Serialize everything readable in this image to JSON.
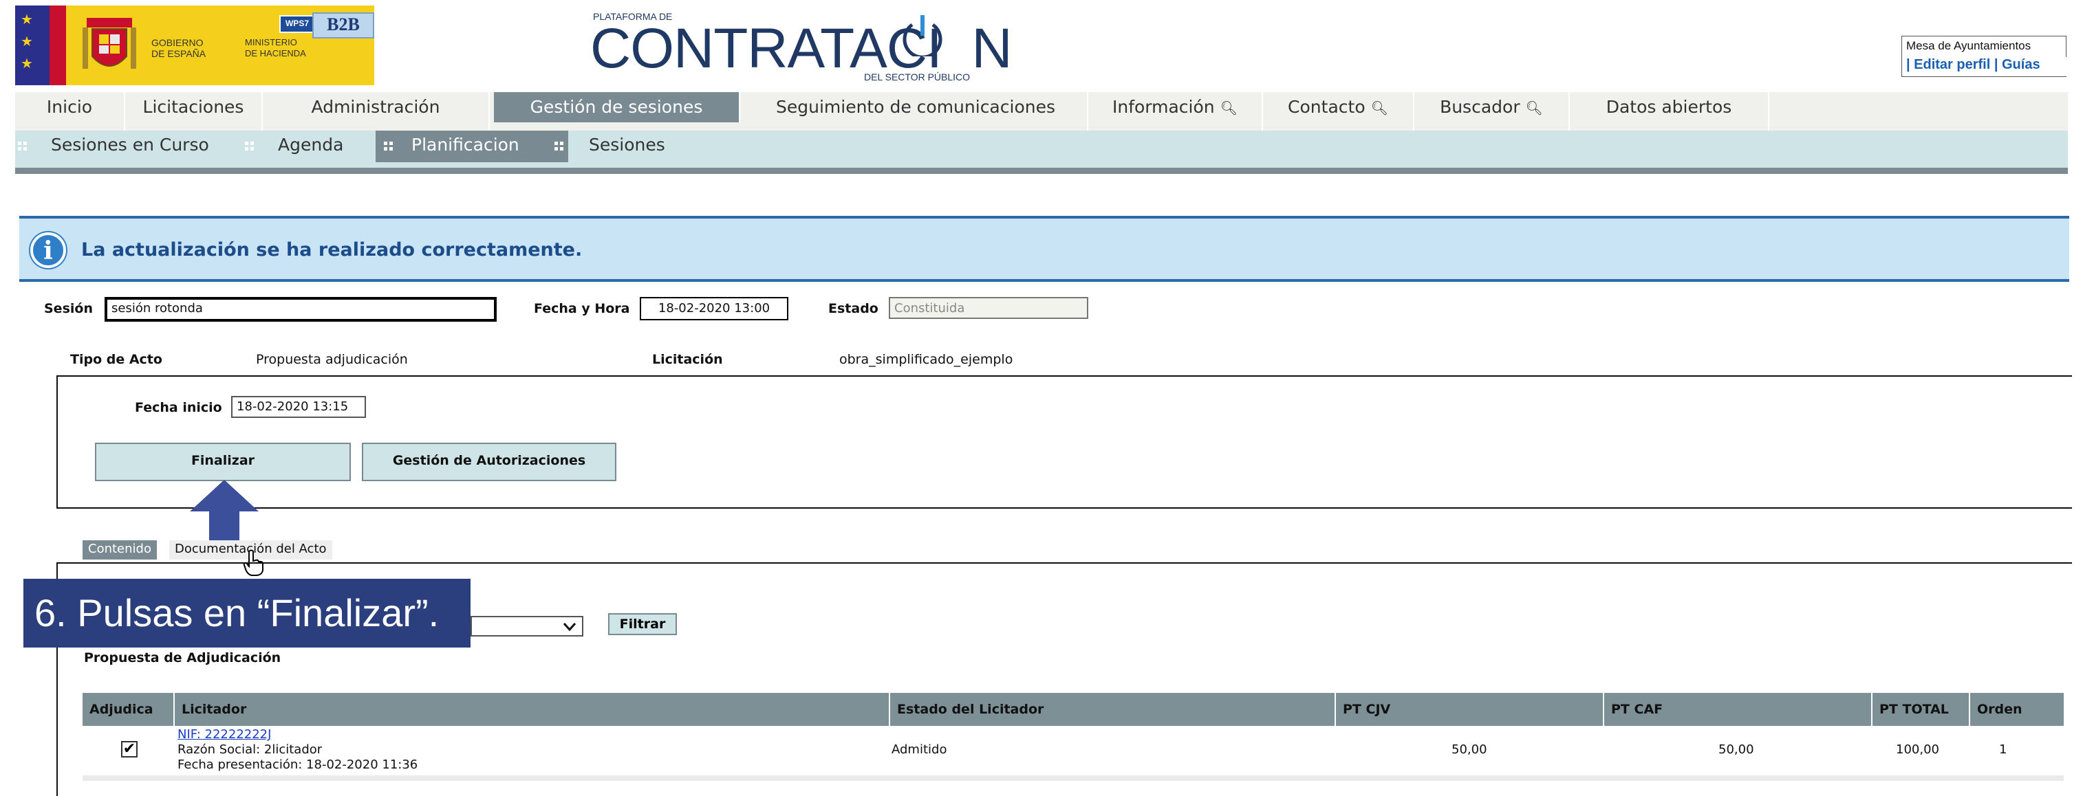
{
  "header": {
    "gobierno": "GOBIERNO\nDE ESPAÑA",
    "ministerio": "MINISTERIO\nDE HACIENDA",
    "wps_badge": "WPS7",
    "b2b_badge": "B2B",
    "platform_small": "PLATAFORMA DE",
    "platform_name": "CONTRATACI  N",
    "platform_sub": "DEL SECTOR PÚBLICO",
    "user_area": "Mesa de Ayuntamientos",
    "user_links": "| Editar perfil | Guías"
  },
  "nav": {
    "items": [
      "Inicio",
      "Licitaciones",
      "Administración",
      "Gestión de sesiones",
      "Seguimiento de comunicaciones",
      "Información",
      "Contacto",
      "Buscador",
      "Datos abiertos"
    ],
    "active": "Gestión de sesiones"
  },
  "subnav": {
    "items": [
      "Sesiones en Curso",
      "Agenda",
      "Planificacion",
      "Sesiones"
    ],
    "active": "Planificacion"
  },
  "info": {
    "message": "La actualización se ha realizado correctamente."
  },
  "session": {
    "sesion_label": "Sesión",
    "sesion_value": "sesión rotonda",
    "fecha_label": "Fecha y Hora",
    "fecha_value": "18-02-2020 13:00",
    "estado_label": "Estado",
    "estado_value": "Constituida",
    "tipo_label": "Tipo de Acto",
    "tipo_value": "Propuesta adjudicación",
    "licitacion_label": "Licitación",
    "licitacion_value": "obra_simplificado_ejemplo"
  },
  "panel": {
    "fecha_inicio_label": "Fecha inicio",
    "fecha_inicio_value": "18-02-2020 13:15",
    "finalizar_label": "Finalizar",
    "autorizaciones_label": "Gestión de Autorizaciones"
  },
  "tabs": {
    "contenido": "Contenido",
    "documentacion": "Documentación del Acto"
  },
  "callout": {
    "text": "6.  Pulsas en “Finalizar”."
  },
  "filter": {
    "button": "Filtrar"
  },
  "propuesta": {
    "title": "Propuesta de Adjudicación",
    "columns": [
      "Adjudica",
      "Licitador",
      "Estado del Licitador",
      "PT CJV",
      "PT CAF",
      "PT TOTAL",
      "Orden"
    ],
    "rows": [
      {
        "nif": "NIF: 22222222J",
        "razon": "Razón Social: 2licitador",
        "fecha": "Fecha presentación: 18-02-2020 11:36",
        "estado": "Admitido",
        "pt_cjv": "50,00",
        "pt_caf": "50,00",
        "pt_total": "100,00",
        "orden": "1",
        "checked": "✔"
      }
    ]
  },
  "colors": {
    "nav_active": "#7a8a92",
    "subnav_bg": "#cfe4e6",
    "info_bg": "#c9e4f4",
    "callout_bg": "#2b3f7e",
    "arrow": "#3b4f9a"
  },
  "icons": [
    "info-icon",
    "magnifier-icon",
    "checkbox-checked-icon",
    "hand-cursor-icon",
    "chevron-down-icon",
    "up-arrow-icon"
  ]
}
